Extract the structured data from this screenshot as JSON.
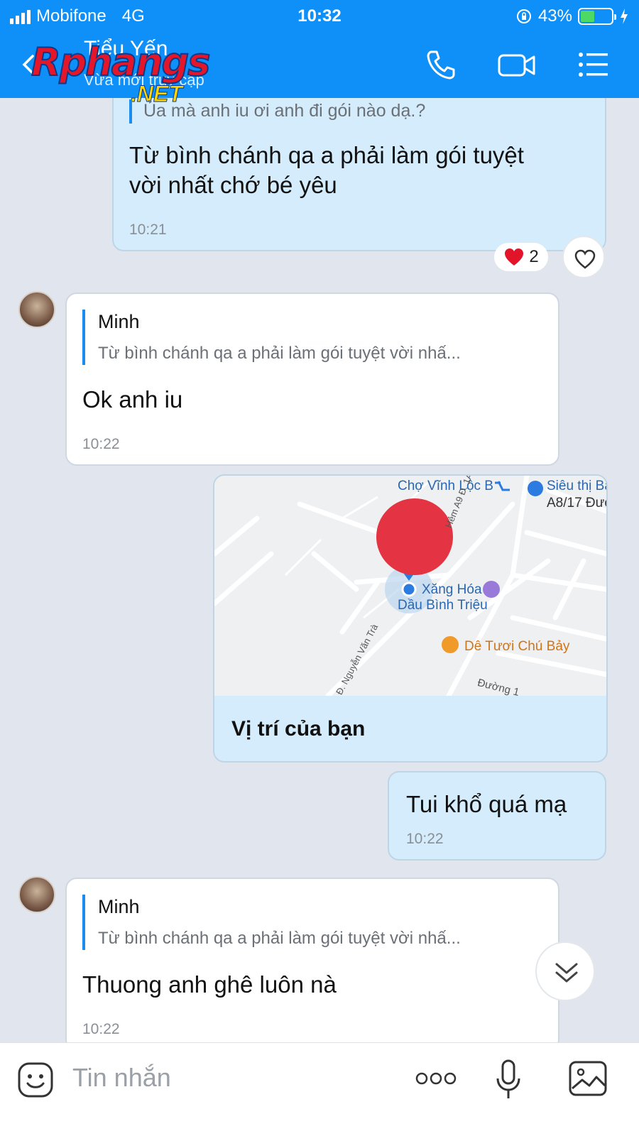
{
  "status_bar": {
    "carrier": "Mobifone",
    "network": "4G",
    "time": "10:32",
    "battery": "43%"
  },
  "header": {
    "contact_name": "Tiểu Yến",
    "contact_status": "Vừa mới truy cập",
    "watermark_main": "Rphangs",
    "watermark_sub": ".NET",
    "icons": [
      "back-icon",
      "phone-icon",
      "video-call-icon",
      "menu-list-icon"
    ],
    "color": "#0f8ff8"
  },
  "messages": {
    "m1": {
      "quote_text": "Ủa mà anh iu ơi anh đi gói nào dạ.?",
      "line1": "Từ bình chánh qa a phải làm gói tuyệt",
      "line2": "vời nhất chớ bé yêu",
      "time": "10:21",
      "reaction_count": "2"
    },
    "m2": {
      "quote_name": "Minh",
      "quote_text": "Từ bình chánh qa a phải làm gói tuyệt vời nhấ...",
      "text": "Ok anh iu",
      "time": "10:22"
    },
    "m3": {
      "caption": "Vị trí của bạn",
      "map_labels": {
        "cho_vinh_loc": "Chợ Vĩnh Lộc B",
        "sieu_thi": "Siêu thị Ba",
        "a8": "A8/17 Đườ",
        "hem": "Hẻm A9 Đ. 1A",
        "xang1": "Xăng Hóa",
        "xang2": "Dầu Bình Triệu",
        "de_tuoi": "Dê Tươi Chú Bảy",
        "nguyen_van_tra": "Đ. Nguyễn Văn Trà",
        "duong": "Đường 1"
      }
    },
    "m4": {
      "text": "Tui khổ quá mạ",
      "time": "10:22"
    },
    "m5": {
      "quote_name": "Minh",
      "quote_text": "Từ bình chánh qa a phải làm gói tuyệt vời nhấ...",
      "text": "Thuong anh ghê luôn nà",
      "time": "10:22"
    }
  },
  "input_bar": {
    "placeholder": "Tin nhắn",
    "icons": [
      "sticker-icon",
      "more-icon",
      "microphone-icon",
      "image-icon"
    ]
  }
}
